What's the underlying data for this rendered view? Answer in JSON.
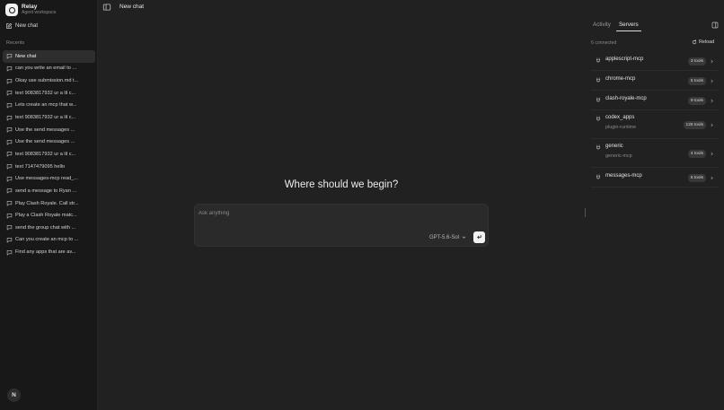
{
  "app": {
    "name": "Relay",
    "subtitle": "Agent workspace"
  },
  "sidebar": {
    "new_chat_label": "New chat",
    "recents_label": "Recents",
    "recents": [
      {
        "label": "New chat",
        "active": true
      },
      {
        "label": "can you write an email to ..."
      },
      {
        "label": "Okay use submission.md t..."
      },
      {
        "label": "text 9083817932 ur a lil c..."
      },
      {
        "label": "Lets create an mcp that w..."
      },
      {
        "label": "text 9083817932 ur a lil c..."
      },
      {
        "label": "Use the send messages ..."
      },
      {
        "label": "Use the send messages ..."
      },
      {
        "label": "text 9083817932 ur a lil c..."
      },
      {
        "label": "text 7147479095 hello"
      },
      {
        "label": "Use messages-mcp read_..."
      },
      {
        "label": "send a message to Ryan ..."
      },
      {
        "label": "Play Clash Royale. Call str..."
      },
      {
        "label": "Play a Clash Royale matc..."
      },
      {
        "label": "send the group chat with ..."
      },
      {
        "label": "Can you create an mcp to ..."
      },
      {
        "label": "Find any apps that are av..."
      }
    ],
    "user_initial": "N"
  },
  "topbar": {
    "title": "New chat"
  },
  "main": {
    "heading": "Where should we begin?",
    "composer": {
      "placeholder": "Ask anything",
      "model": "GPT-5.6-Sol"
    }
  },
  "panel": {
    "tabs": [
      {
        "label": "Activity"
      },
      {
        "label": "Servers",
        "active": true
      }
    ],
    "connected": "6 connected",
    "reload_label": "Reload",
    "servers": [
      {
        "name": "applescript-mcp",
        "tools": "3 tools"
      },
      {
        "name": "chrome-mcp",
        "tools": "5 tools"
      },
      {
        "name": "clash-royale-mcp",
        "tools": "9 tools"
      },
      {
        "name": "codex_apps",
        "sub": "plugin-runtime",
        "tools": "125 tools"
      },
      {
        "name": "generic",
        "sub": "generic-mcp",
        "tools": "4 tools"
      },
      {
        "name": "messages-mcp",
        "tools": "6 tools"
      }
    ]
  },
  "colors": {
    "background": "#212121",
    "sidebar": "#181818",
    "composer": "#2a2a2a",
    "badge": "#383838",
    "active_item": "#2e2e2e",
    "text": "#e8e8e8",
    "muted": "#8a8a8a"
  },
  "icons": {
    "brand": "ring-logo-icon",
    "new_chat": "compose-icon",
    "recent": "chat-bubble-icon",
    "toggle": "sidebar-toggle-icon",
    "send": "return-arrow-icon",
    "model": "chevron-down-icon",
    "reload": "refresh-icon",
    "server": "plug-icon",
    "row": "chevron-right-icon",
    "panel": "panel-toggle-icon"
  }
}
